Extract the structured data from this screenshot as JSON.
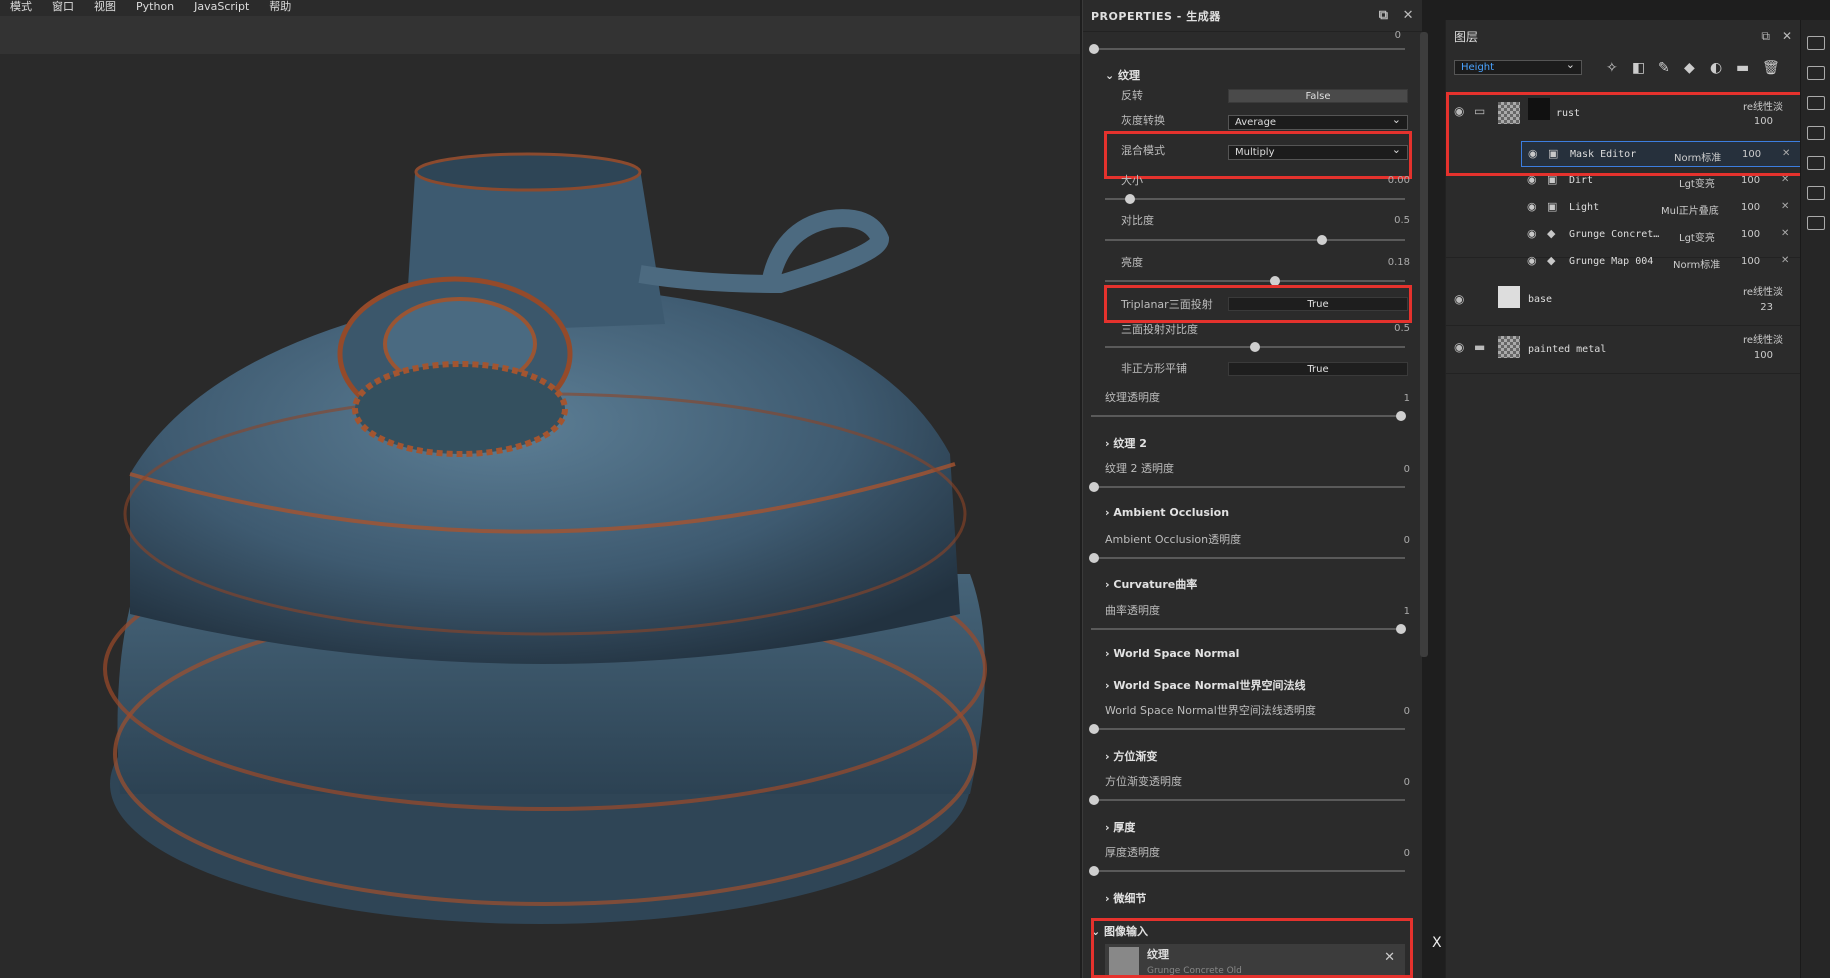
{
  "menu": [
    "模式",
    "窗口",
    "视图",
    "Python",
    "JavaScript",
    "帮助"
  ],
  "props": {
    "title": "PROPERTIES - 生成器",
    "top_value": "0",
    "texture_section": "纹理",
    "invert_label": "反转",
    "invert_value": "False",
    "gray_label": "灰度转换",
    "gray_value": "Average",
    "blend_label": "混合模式",
    "blend_value": "Multiply",
    "size_label": "大小",
    "size_value": "0.00",
    "contrast_label": "对比度",
    "contrast_value": "0.5",
    "brightness_label": "亮度",
    "brightness_value": "0.18",
    "triplanar_label": "Triplanar三面投射",
    "triplanar_value": "True",
    "tri_contrast_label": "三面投射对比度",
    "tri_contrast_value": "0.5",
    "nonsquare_label": "非正方形平铺",
    "nonsquare_value": "True",
    "tex_opacity_label": "纹理透明度",
    "tex_opacity_value": "1",
    "texture2_section": "纹理 2",
    "tex2_opacity_label": "纹理 2 透明度",
    "tex2_opacity_value": "0",
    "ao_section": "Ambient Occlusion",
    "ao_opacity_label": "Ambient Occlusion透明度",
    "ao_opacity_value": "0",
    "curv_section": "Curvature曲率",
    "curv_opacity_label": "曲率透明度",
    "curv_opacity_value": "1",
    "wsn_section": "World Space Normal",
    "wsn2_section": "World Space Normal世界空间法线",
    "wsn_opacity_label": "World Space Normal世界空间法线透明度",
    "wsn_opacity_value": "0",
    "dir_section": "方位渐变",
    "dir_opacity_label": "方位渐变透明度",
    "dir_opacity_value": "0",
    "thick_section": "厚度",
    "thick_opacity_label": "厚度透明度",
    "thick_opacity_value": "0",
    "micro_section": "微细节",
    "image_input_section": "图像输入",
    "image_input_item": "纹理",
    "image_input_sub": "Grunge Concrete Old"
  },
  "layers": {
    "title": "图层",
    "channel": "Height",
    "items": [
      {
        "name": "rust",
        "blend": "re线性淡",
        "opacity": "100"
      },
      {
        "name": "base",
        "blend": "re线性淡",
        "opacity": "23"
      },
      {
        "name": "painted metal",
        "blend": "re线性淡",
        "opacity": "100"
      }
    ],
    "subs": [
      {
        "name": "Mask Editor",
        "blend": "Norm标准",
        "opacity": "100"
      },
      {
        "name": "Dirt",
        "blend": "Lgt变亮",
        "opacity": "100"
      },
      {
        "name": "Light",
        "blend": "Mul正片叠底",
        "opacity": "100"
      },
      {
        "name": "Grunge Concret…",
        "blend": "Lgt变亮",
        "opacity": "100"
      },
      {
        "name": "Grunge Map 004",
        "blend": "Norm标准",
        "opacity": "100"
      }
    ]
  },
  "stray_x": "X"
}
